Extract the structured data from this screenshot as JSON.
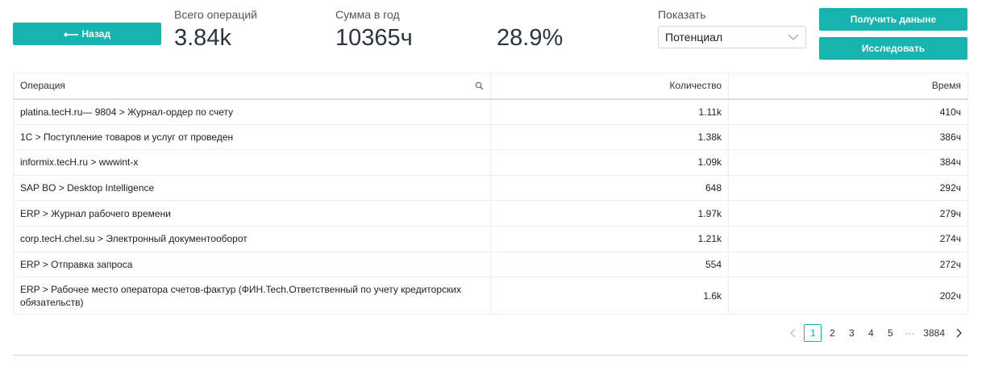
{
  "header": {
    "back_label": "Назад",
    "total_ops_label": "Всего операций",
    "total_ops_value": "3.84k",
    "year_sum_label": "Сумма в год",
    "year_sum_value": "10365ч",
    "percent_value": "28.9%",
    "show_label": "Показать",
    "show_selected": "Потенциал",
    "get_data_label": "Получить даныне",
    "research_label": "Исследовать"
  },
  "table": {
    "columns": {
      "operation": "Операция",
      "quantity": "Количество",
      "time": "Время"
    },
    "rows": [
      {
        "operation": "platina.tecH.ru— 9804 > Журнал-ордер по счету",
        "quantity": "1.11k",
        "time": "410ч"
      },
      {
        "operation": "1С > Поступление товаров и услуг от проведен",
        "quantity": "1.38k",
        "time": "386ч"
      },
      {
        "operation": "informix.tecH.ru > wwwint-x",
        "quantity": "1.09k",
        "time": "384ч"
      },
      {
        "operation": "SAP BO > Desktop Intelligence",
        "quantity": "648",
        "time": "292ч"
      },
      {
        "operation": "ERP > Журнал рабочего времени",
        "quantity": "1.97k",
        "time": "279ч"
      },
      {
        "operation": "corp.tecH.chel.su > Электронный документооборот",
        "quantity": "1.21k",
        "time": "274ч"
      },
      {
        "operation": "ERP > Отправка запроса",
        "quantity": "554",
        "time": "272ч"
      },
      {
        "operation": "ERP > Рабочее место оператора счетов-фактур (ФИН.Tech.Ответственный по учету кредиторских обязательств)",
        "quantity": "1.6k",
        "time": "202ч"
      }
    ]
  },
  "pagination": {
    "pages": [
      "1",
      "2",
      "3",
      "4",
      "5"
    ],
    "ellipsis": "···",
    "last_page": "3884",
    "current": "1"
  },
  "colors": {
    "accent": "#17b3ae"
  }
}
